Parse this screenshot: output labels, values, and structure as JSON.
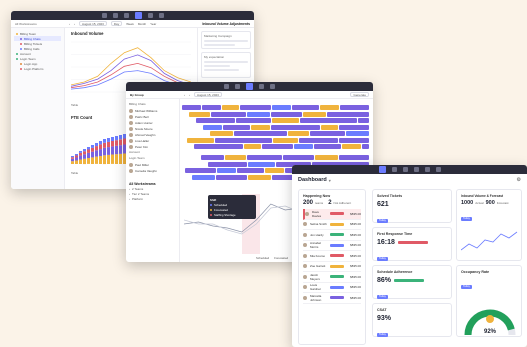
{
  "w1": {
    "date": "August 15, 2023",
    "nav": [
      "Day",
      "Week",
      "Month",
      "Year"
    ],
    "sidebar_title": "All Workstreams",
    "tree": [
      {
        "label": "Billing Team",
        "color": "#f0b33c",
        "sel": false
      },
      {
        "label": "Billing Chats",
        "color": "#7a61e0",
        "sel": true
      },
      {
        "label": "Billing Tickets",
        "color": "#e05a66",
        "sel": false
      },
      {
        "label": "Billing Calls",
        "color": "#6b7cff",
        "sel": false
      },
      {
        "label": "Account",
        "color": "#3bb37a",
        "sel": false
      },
      {
        "label": "Login Team",
        "color": "#3bb37a",
        "sel": false
      },
      {
        "label": "Login App",
        "color": "#e08a3c",
        "sel": false
      },
      {
        "label": "Login Platform",
        "color": "#e05a66",
        "sel": false
      }
    ],
    "chart1_title": "Inbound Volume",
    "chart2_title": "FTE Count",
    "table_label": "Table",
    "panel_title": "Inbound Volume Adjustments",
    "panel_items": [
      "Marketing Campaign",
      "My expectation"
    ]
  },
  "w2": {
    "group_by": "By Group",
    "date": "August 15, 2023",
    "generate_label": "Generate",
    "group1": "Billing Chats",
    "people1": [
      "Michael Williams",
      "Patric Bell",
      "Adam Hunter",
      "Nicole Moore",
      "Ahmad Vaughn",
      "Lisa Haller",
      "Peter Kim"
    ],
    "group2": "Account",
    "group3": "Login Team",
    "people2": [
      "Paul Miller",
      "Camelia Vaughn"
    ],
    "workstreams_title": "All Workstreams",
    "ws_items": [
      "2 Teams",
      "Tier 2 Teams",
      "Platform"
    ],
    "tooltip": {
      "title": "Shift",
      "rows": [
        "Scheduled",
        "Forecasted",
        "Staffing Shortage"
      ]
    },
    "legend": [
      "Scheduled",
      "Forecasted"
    ]
  },
  "w3": {
    "title": "Dashboard",
    "happening": {
      "title": "Happening Now",
      "count1": "200",
      "count1_label": "teams",
      "count2": "2",
      "count2_label": "Not Adherent"
    },
    "list": [
      {
        "name": "Dave Davies",
        "val": "$835.00",
        "color": "#e05a66",
        "hl": true
      },
      {
        "name": "Selina Smith",
        "val": "$835.00",
        "color": "#f0b33c",
        "hl": false
      },
      {
        "name": "Jon Hardy",
        "val": "$835.00",
        "color": "#3bb37a",
        "hl": false
      },
      {
        "name": "Annabel Morris",
        "val": "$835.00",
        "color": "#6b7cff",
        "hl": false
      },
      {
        "name": "Mia Kosmo",
        "val": "$835.00",
        "color": "#e05a66",
        "hl": false
      },
      {
        "name": "Zoe Garrett",
        "val": "$835.00",
        "color": "#f0b33c",
        "hl": false
      },
      {
        "name": "Jacob Meyers",
        "val": "$835.00",
        "color": "#3bb37a",
        "hl": false
      },
      {
        "name": "Louis Gardner",
        "val": "$835.00",
        "color": "#6b7cff",
        "hl": false
      },
      {
        "name": "Marcella Johnson",
        "val": "$835.00",
        "color": "#7a61e0",
        "hl": false
      }
    ],
    "solved": {
      "title": "Solved Tickets",
      "value": "621",
      "badge": "Today"
    },
    "frt": {
      "title": "First Response Time",
      "value": "16:18",
      "badge": "Today"
    },
    "adh": {
      "title": "Schedule Adherence",
      "value": "86%",
      "badge": "Today"
    },
    "csat": {
      "title": "CSAT",
      "value": "93%",
      "badge": "Today"
    },
    "inbound": {
      "title": "Inbound Volume & Forecast",
      "v1": "1000",
      "v1_label": "Actual",
      "v2": "900",
      "v2_label": "Forecast",
      "badge": "Today"
    },
    "occupancy": {
      "title": "Occupancy Rate",
      "value": "92%",
      "badge": "Today",
      "fraction": 0.92
    }
  },
  "chart_data": {
    "type": "line",
    "title": "Inbound Volume",
    "series": [
      {
        "values": [
          10,
          14,
          22,
          40,
          55,
          62,
          48,
          30,
          20,
          14
        ],
        "color": "#f0b33c"
      },
      {
        "values": [
          8,
          12,
          18,
          30,
          46,
          52,
          44,
          26,
          16,
          10
        ],
        "color": "#7a61e0"
      },
      {
        "values": [
          6,
          9,
          14,
          24,
          36,
          40,
          34,
          22,
          13,
          8
        ],
        "color": "#e05a66"
      },
      {
        "values": [
          4,
          6,
          10,
          18,
          28,
          30,
          26,
          16,
          10,
          6
        ],
        "color": "#6b7cff"
      }
    ],
    "ylim": [
      0,
      70
    ]
  },
  "colors": {
    "accent": "#6b7cff",
    "orange": "#f0b33c",
    "purple": "#7a61e0",
    "red": "#e05a66",
    "green": "#3bb37a",
    "topbar": "#2b2c3a"
  }
}
